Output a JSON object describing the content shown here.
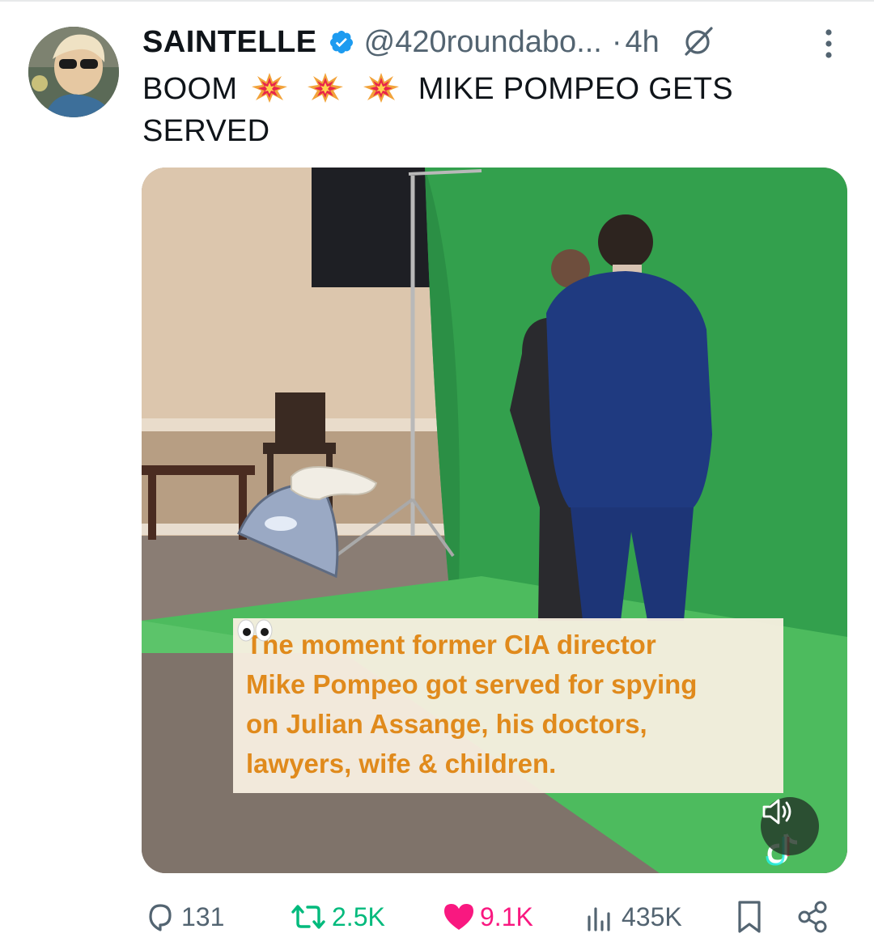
{
  "tweet": {
    "display_name": "SAINTELLE",
    "handle": "@420roundabo...",
    "separator": "·",
    "time": "4h",
    "text_start": "BOOM",
    "text_end": "MIKE POMPEO GETS",
    "text_line2": "SERVED",
    "emojis": [
      "collision-icon",
      "collision-icon",
      "collision-icon"
    ]
  },
  "media": {
    "caption_lines": [
      "The moment former CIA director",
      "Mike Pompeo got served for spying",
      "on Julian Assange, his doctors,",
      "lawyers, wife & children."
    ],
    "caption_emoji": "eyes-icon",
    "mute_icon": "speaker-icon"
  },
  "actions": {
    "replies": "131",
    "reposts": "2.5K",
    "likes": "9.1K",
    "views": "435K"
  },
  "colors": {
    "text": "#0f1419",
    "secondary": "#536471",
    "verified": "#1d9bf0",
    "like": "#f91880",
    "repost": "#00ba7c",
    "caption": "#e08a1c",
    "green_screen": "#2fa24d"
  }
}
